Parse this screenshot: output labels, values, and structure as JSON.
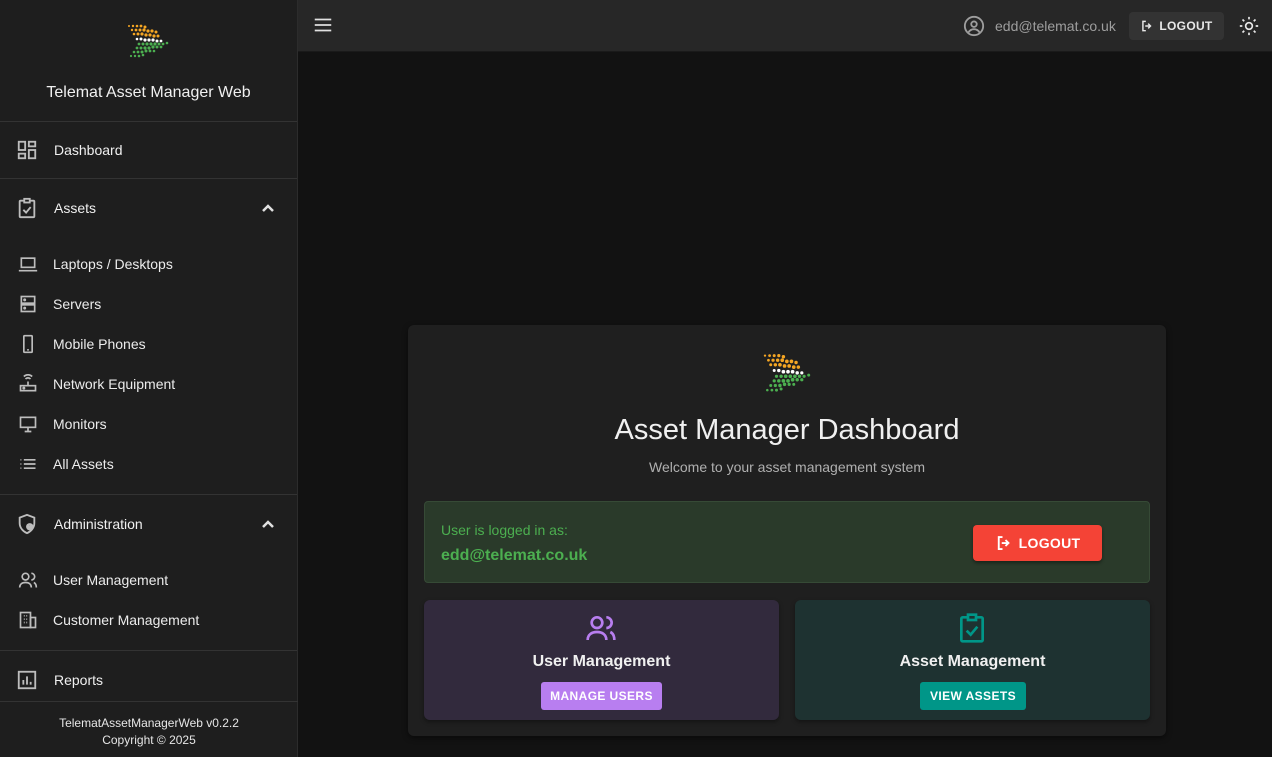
{
  "sidebar": {
    "app_title": "Telemat Asset Manager Web",
    "dashboard_label": "Dashboard",
    "assets": {
      "label": "Assets",
      "items": [
        {
          "label": "Laptops / Desktops",
          "icon": "laptop-icon"
        },
        {
          "label": "Servers",
          "icon": "server-icon"
        },
        {
          "label": "Mobile Phones",
          "icon": "phone-icon"
        },
        {
          "label": "Network Equipment",
          "icon": "router-icon"
        },
        {
          "label": "Monitors",
          "icon": "monitor-icon"
        },
        {
          "label": "All Assets",
          "icon": "list-icon"
        }
      ]
    },
    "administration": {
      "label": "Administration",
      "items": [
        {
          "label": "User Management",
          "icon": "users-icon"
        },
        {
          "label": "Customer Management",
          "icon": "building-icon"
        }
      ]
    },
    "reports_label": "Reports",
    "footer": {
      "version": "TelematAssetManagerWeb v0.2.2",
      "copyright": "Copyright © 2025"
    }
  },
  "topbar": {
    "user_email": "edd@telemat.co.uk",
    "logout_label": "LOGOUT"
  },
  "main": {
    "title": "Asset Manager Dashboard",
    "subtitle": "Welcome to your asset management system",
    "login_box": {
      "label": "User is logged in as:",
      "user": "edd@telemat.co.uk",
      "logout_label": "LOGOUT"
    },
    "tiles": {
      "users": {
        "title": "User Management",
        "button": "MANAGE USERS"
      },
      "assets": {
        "title": "Asset Management",
        "button": "VIEW ASSETS"
      }
    }
  },
  "colors": {
    "logo_orange": "#f5a623",
    "logo_green": "#4caf50",
    "logout_red": "#f44336",
    "users_accent": "#b87ef0",
    "assets_accent": "#009688"
  }
}
